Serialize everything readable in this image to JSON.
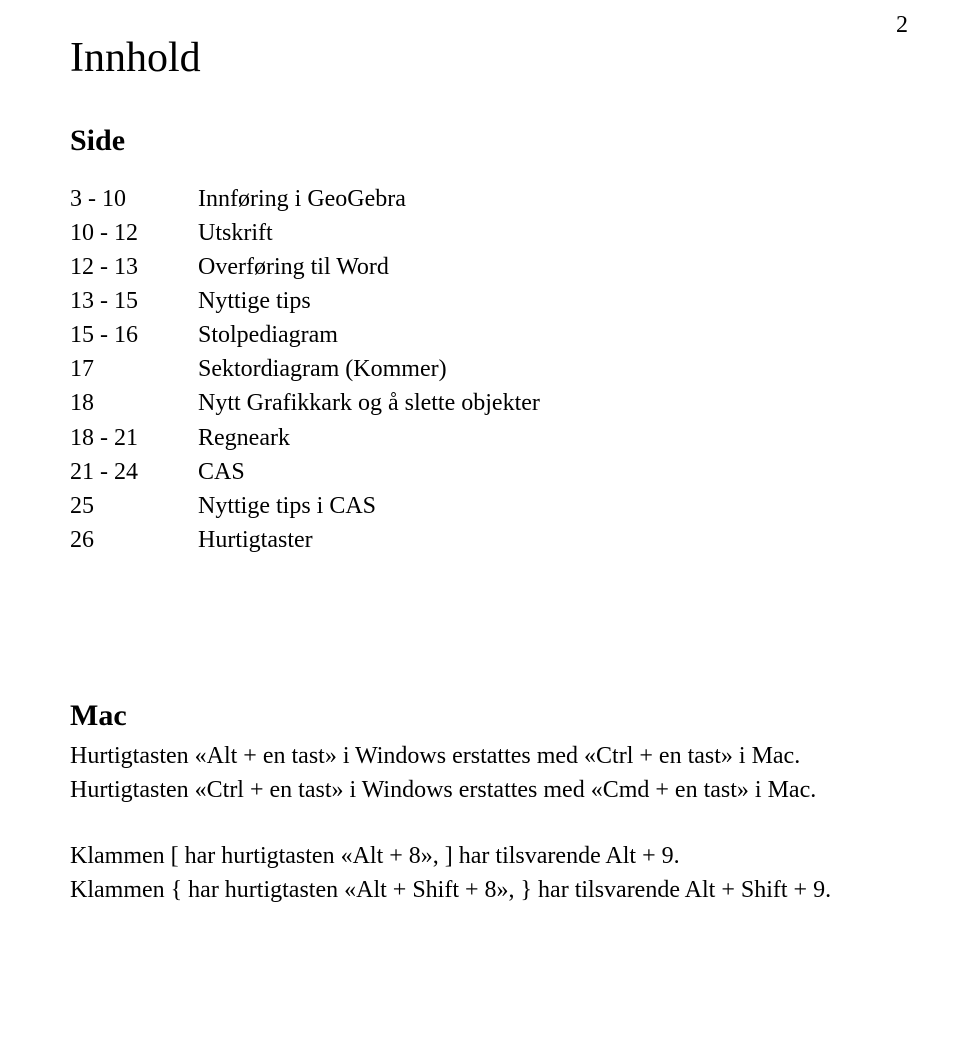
{
  "pageNumber": "2",
  "title": "Innhold",
  "sideLabel": "Side",
  "toc": [
    {
      "page": "3 - 10",
      "title": "Innføring i GeoGebra"
    },
    {
      "page": "10 - 12",
      "title": "Utskrift"
    },
    {
      "page": "12 - 13",
      "title": "Overføring til Word"
    },
    {
      "page": "13 - 15",
      "title": "Nyttige tips"
    },
    {
      "page": "15 - 16",
      "title": "Stolpediagram"
    },
    {
      "page": "17",
      "title": "Sektordiagram   (Kommer)"
    },
    {
      "page": "18",
      "title": "Nytt Grafikkark og å slette objekter"
    },
    {
      "page": "18 - 21",
      "title": "Regneark"
    },
    {
      "page": "21 - 24",
      "title": "CAS"
    },
    {
      "page": "25",
      "title": "Nyttige tips i CAS"
    },
    {
      "page": "26",
      "title": "Hurtigtaster"
    }
  ],
  "macHeading": "Mac",
  "macLines": {
    "l1": "Hurtigtasten «Alt + en tast» i Windows erstattes med «Ctrl + en tast» i Mac.",
    "l2": "Hurtigtasten «Ctrl + en tast» i Windows erstattes med «Cmd + en tast» i Mac.",
    "l3": "Klammen [ har hurtigtasten «Alt + 8», ] har tilsvarende Alt + 9.",
    "l4": "Klammen { har hurtigtasten «Alt + Shift + 8», } har tilsvarende Alt + Shift + 9."
  }
}
